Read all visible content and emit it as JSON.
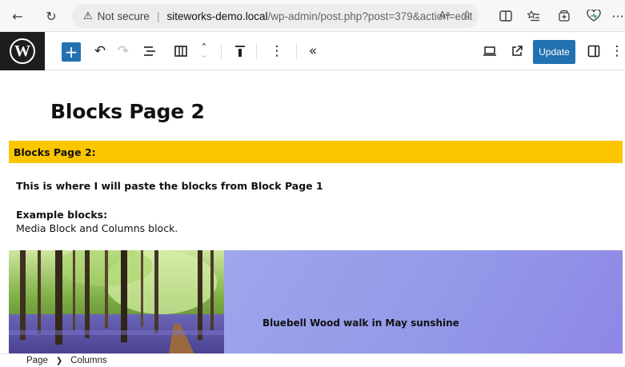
{
  "browser": {
    "security_label": "Not secure",
    "url_host": "siteworks-demo.local",
    "url_path": "/wp-admin/post.php?post=379&action=edit",
    "reader_label": "Aᵃ",
    "more_label": "···"
  },
  "toolbar": {
    "update_label": "Update"
  },
  "content": {
    "title": "Blocks Page 2",
    "highlight": "Blocks Page 2:",
    "intro": "This is where I will paste the blocks from Block Page 1",
    "examples_heading": "Example blocks:",
    "examples_text": "Media Block and Columns block.",
    "media_caption": "Bluebell Wood walk in May sunshine"
  },
  "breadcrumb": {
    "items": [
      "Page",
      "Columns"
    ]
  },
  "colors": {
    "accent": "#2271b1",
    "highlight_bar": "#fbc500",
    "media_bg": "#9399e8",
    "wp_logo_bg": "#1e1e1e"
  }
}
